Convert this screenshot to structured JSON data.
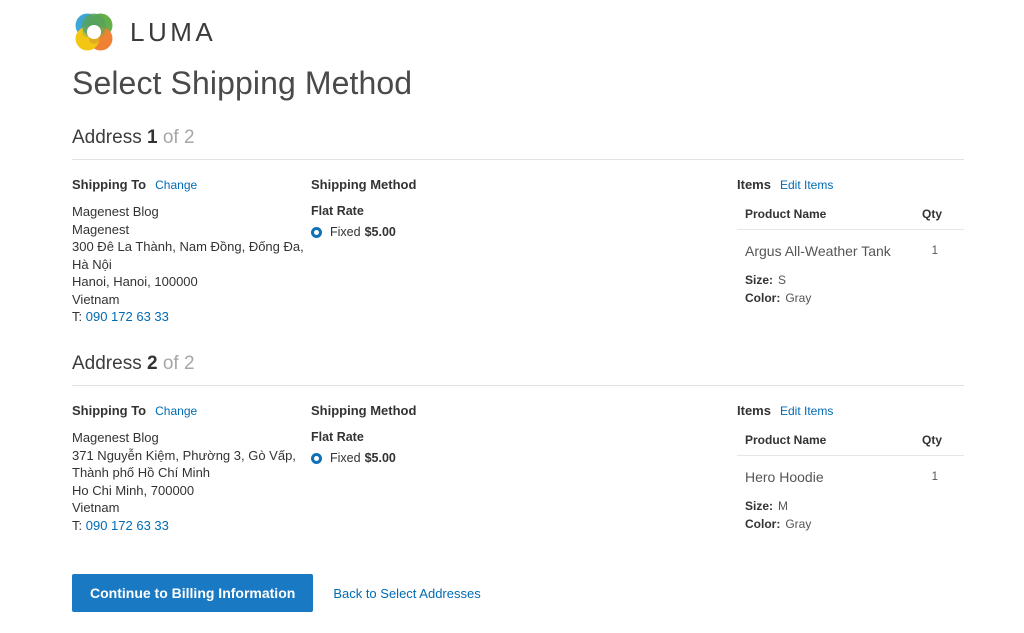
{
  "brand": {
    "name": "LUMA",
    "logo_colors": {
      "blue": "#2e9fd4",
      "green": "#56a93a",
      "orange": "#ee7623",
      "yellow": "#f2c200",
      "olive": "#8a8f32",
      "brown": "#a6642b"
    }
  },
  "page_title": "Select Shipping Method",
  "theme": {
    "link_color": "#006bb4",
    "button_color": "#1979c3",
    "radio_color": "#0f72b8",
    "text_color": "#333333",
    "muted_color": "#a6a6a6"
  },
  "labels": {
    "address_word": "Address",
    "of_word": "of",
    "shipping_to": "Shipping To",
    "change_link": "Change",
    "shipping_method": "Shipping Method",
    "items": "Items",
    "edit_items_link": "Edit Items",
    "col_product_name": "Product Name",
    "col_qty": "Qty",
    "phone_prefix": "T:"
  },
  "addresses": [
    {
      "index": "1",
      "total": "2",
      "recipient_lines": [
        "Magenest Blog",
        "Magenest",
        "300 Đê La Thành, Nam Đồng, Đống Đa,",
        "Hà Nội",
        "Hanoi, Hanoi, 100000",
        "Vietnam"
      ],
      "phone": "090 172 63 33",
      "shipping_method": {
        "carrier": "Flat Rate",
        "option_label": "Fixed",
        "option_price": "$5.00",
        "selected": true
      },
      "items": [
        {
          "name": "Argus All-Weather Tank",
          "qty": "1",
          "options": [
            {
              "label": "Size:",
              "value": "S"
            },
            {
              "label": "Color:",
              "value": "Gray"
            }
          ]
        }
      ]
    },
    {
      "index": "2",
      "total": "2",
      "recipient_lines": [
        "Magenest Blog",
        "371 Nguyễn Kiệm, Phường 3, Gò Vấp,",
        "Thành phố Hồ Chí Minh",
        "Ho Chi Minh, 700000",
        "Vietnam"
      ],
      "phone": "090 172 63 33",
      "shipping_method": {
        "carrier": "Flat Rate",
        "option_label": "Fixed",
        "option_price": "$5.00",
        "selected": true
      },
      "items": [
        {
          "name": "Hero Hoodie",
          "qty": "1",
          "options": [
            {
              "label": "Size:",
              "value": "M"
            },
            {
              "label": "Color:",
              "value": "Gray"
            }
          ]
        }
      ]
    }
  ],
  "actions": {
    "continue_button": "Continue to Billing Information",
    "back_link": "Back to Select Addresses"
  }
}
